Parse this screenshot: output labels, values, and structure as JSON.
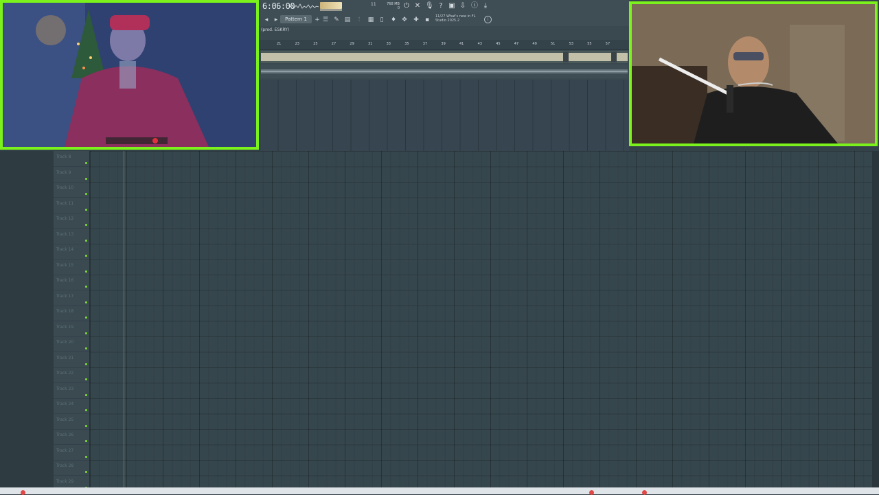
{
  "transport": {
    "time": "6:06:00",
    "stat_top": "11",
    "stat_right": "768 MB\n0"
  },
  "pattern": {
    "label": "Pattern 1"
  },
  "news": {
    "text": "11/27 What's new in FL Studio 2025.2"
  },
  "song": {
    "title": "(prod. ESKRY)"
  },
  "ruler": [
    "21",
    "23",
    "25",
    "27",
    "29",
    "31",
    "33",
    "35",
    "37",
    "39",
    "41",
    "43",
    "45",
    "47",
    "49",
    "51",
    "53",
    "55",
    "57"
  ],
  "tracks": [
    "Track 8",
    "Track 9",
    "Track 10",
    "Track 11",
    "Track 12",
    "Track 13",
    "Track 14",
    "Track 15",
    "Track 16",
    "Track 17",
    "Track 18",
    "Track 19",
    "Track 20",
    "Track 21",
    "Track 22",
    "Track 23",
    "Track 24",
    "Track 25",
    "Track 26",
    "Track 27",
    "Track 28",
    "Track 29"
  ],
  "icons": {
    "toolbar_top": [
      "power-icon",
      "close-x-icon",
      "mic-icon",
      "help-icon",
      "save-icon",
      "export-icon",
      "download-icon",
      "info-icon",
      "download-alt-icon"
    ],
    "toolbar_bottom": [
      "playlist-icon",
      "brush-icon",
      "channel-rack-icon",
      "mixer-icon",
      "piano-roll-icon",
      "browser-icon",
      "plugin-icon",
      "pick-icon",
      "paint-icon",
      "cpu-icon"
    ]
  },
  "colors": {
    "cam_border": "#7cf21c",
    "track_led": "#7ad43a",
    "grid_bg": "#36464d"
  }
}
